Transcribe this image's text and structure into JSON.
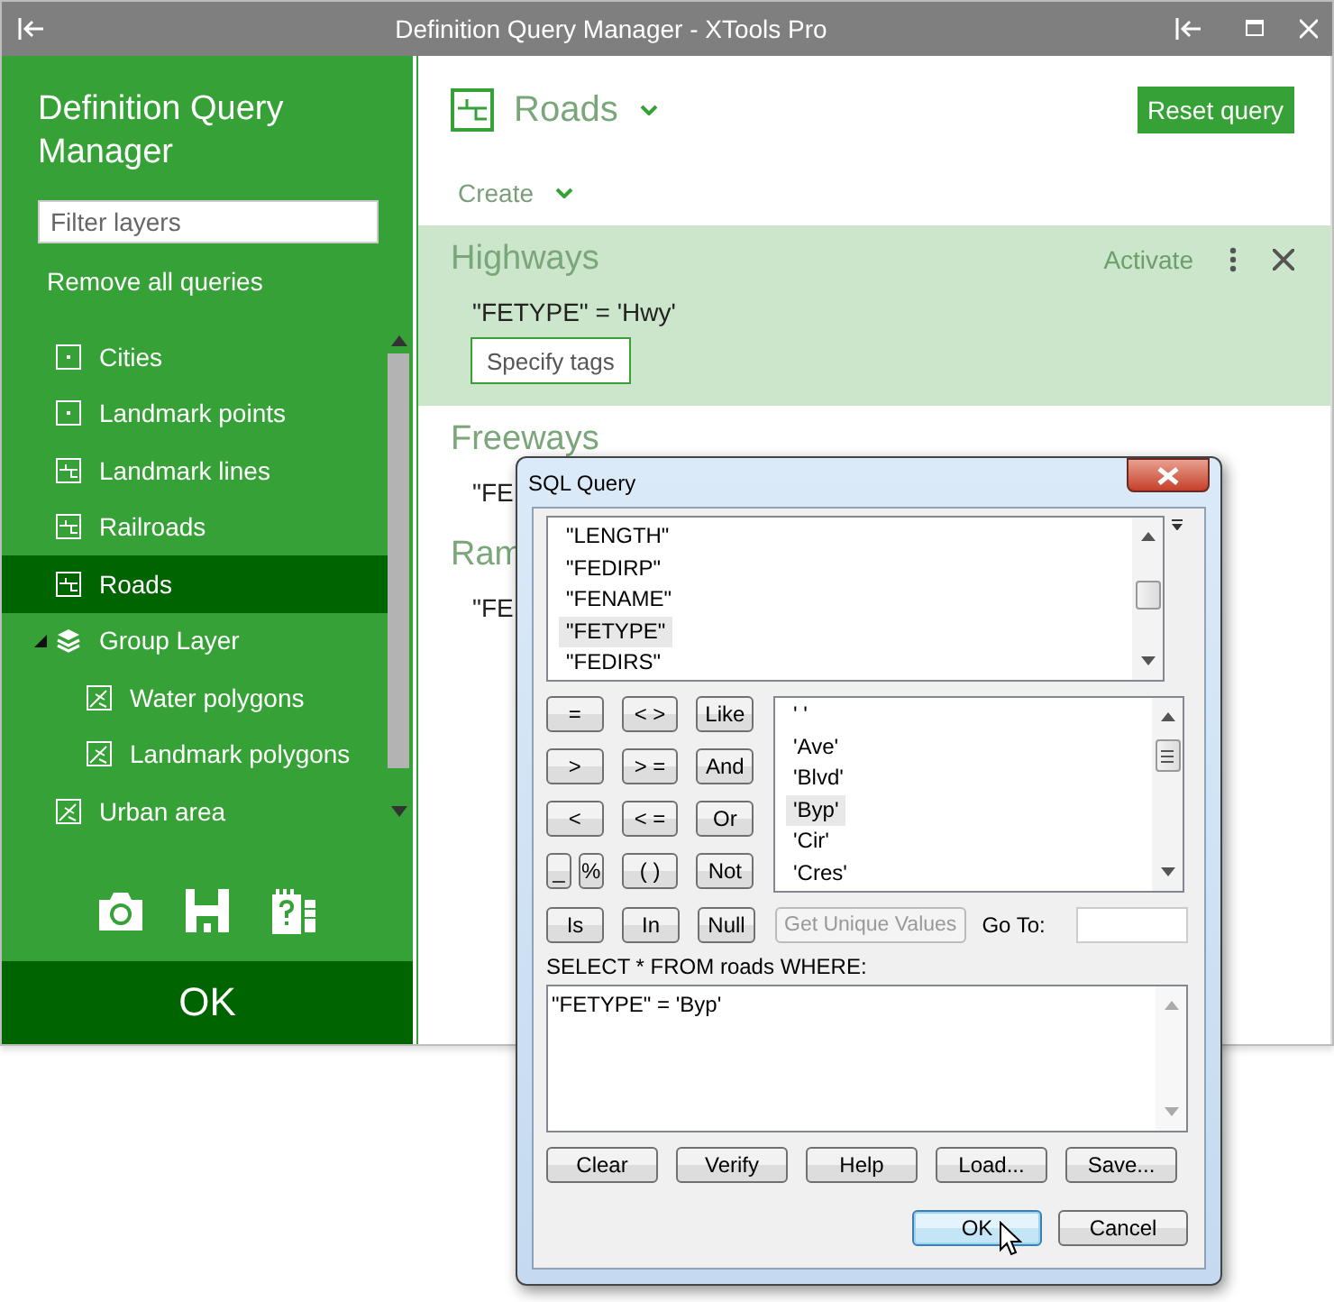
{
  "window": {
    "title": "Definition Query Manager - XTools Pro"
  },
  "sidebar": {
    "title": "Definition Query Manager",
    "filter": {
      "placeholder": "Filter layers"
    },
    "remove_all": "Remove all queries",
    "layers": [
      {
        "name": "Cities",
        "kind": "point",
        "selected": false
      },
      {
        "name": "Landmark points",
        "kind": "point",
        "selected": false
      },
      {
        "name": "Landmark lines",
        "kind": "line",
        "selected": false
      },
      {
        "name": "Railroads",
        "kind": "line",
        "selected": false
      },
      {
        "name": "Roads",
        "kind": "line",
        "selected": true
      },
      {
        "name": "Group Layer",
        "kind": "group",
        "selected": false,
        "expanded": true,
        "children": [
          {
            "name": "Water polygons",
            "kind": "polygon",
            "selected": false
          },
          {
            "name": "Landmark polygons",
            "kind": "polygon",
            "selected": false
          }
        ]
      },
      {
        "name": "Urban area",
        "kind": "polygon",
        "selected": false
      }
    ],
    "ok": "OK"
  },
  "layer_header": {
    "name": "Roads",
    "kind": "line"
  },
  "reset_button": "Reset query",
  "create_menu": "Create",
  "queries": [
    {
      "title": "Highways",
      "query": "\"FETYPE\" = 'Hwy'",
      "active": true,
      "activate": "Activate",
      "tags_button": "Specify tags"
    },
    {
      "title": "Freeways",
      "query": "\"FE",
      "active": false
    },
    {
      "title": "Ram",
      "query": "\"FE",
      "active": false
    }
  ],
  "dialog": {
    "title": "SQL Query",
    "fields": [
      {
        "name": "\"LENGTH\"",
        "selected": false
      },
      {
        "name": "\"FEDIRP\"",
        "selected": false
      },
      {
        "name": "\"FENAME\"",
        "selected": false
      },
      {
        "name": "\"FETYPE\"",
        "selected": true
      },
      {
        "name": "\"FEDIRS\"",
        "selected": false
      }
    ],
    "operator_rows": [
      [
        {
          "label": "=",
          "kind": "full"
        },
        {
          "label": "< >",
          "kind": "full"
        },
        {
          "label": "Like",
          "kind": "full"
        }
      ],
      [
        {
          "label": ">",
          "kind": "full"
        },
        {
          "label": "> =",
          "kind": "full"
        },
        {
          "label": "And",
          "kind": "full"
        }
      ],
      [
        {
          "label": "<",
          "kind": "full"
        },
        {
          "label": "< =",
          "kind": "full"
        },
        {
          "label": "Or",
          "kind": "full"
        }
      ],
      [
        {
          "label": "_",
          "kind": "half"
        },
        {
          "label": "%",
          "kind": "half"
        },
        {
          "label": "( )",
          "kind": "full"
        },
        {
          "label": "Not",
          "kind": "full"
        }
      ]
    ],
    "values": [
      {
        "value": "' '",
        "selected": false
      },
      {
        "value": "'Ave'",
        "selected": false
      },
      {
        "value": "'Blvd'",
        "selected": false
      },
      {
        "value": "'Byp'",
        "selected": true
      },
      {
        "value": "'Cir'",
        "selected": false
      },
      {
        "value": "'Cres'",
        "selected": false
      }
    ],
    "row_buttons": [
      "Is",
      "In",
      "Null"
    ],
    "unique_button": {
      "label": "Get Unique Values",
      "disabled": true
    },
    "goto_label": "Go To:",
    "sql_label": "SELECT * FROM roads WHERE:",
    "expression": "\"FETYPE\" = 'Byp'",
    "actions": [
      "Clear",
      "Verify",
      "Help",
      "Load...",
      "Save..."
    ],
    "ok": {
      "label": "OK",
      "default": true
    },
    "cancel": "Cancel"
  }
}
